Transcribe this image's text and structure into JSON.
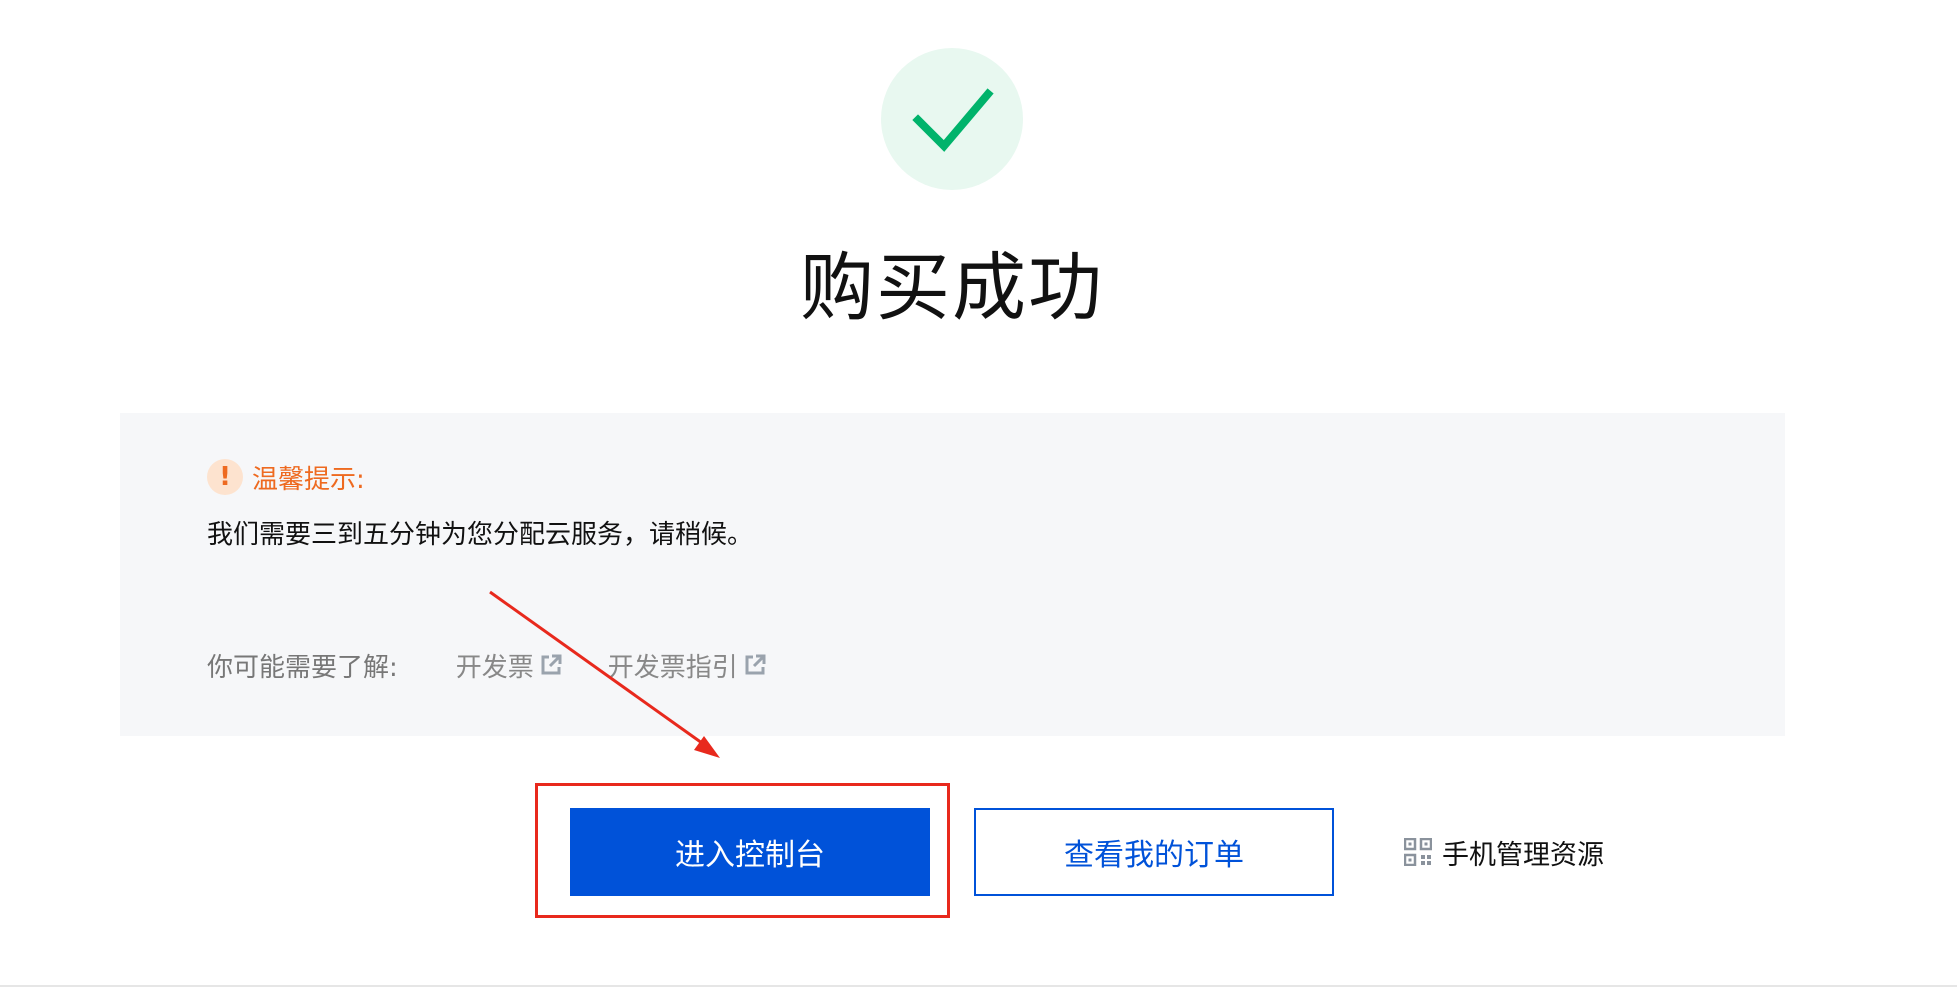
{
  "status": {
    "icon": "check-icon",
    "title": "购买成功",
    "accent_color": "#00b36b"
  },
  "notice": {
    "icon": "warning-icon",
    "title": "温馨提示:",
    "message": "我们需要三到五分钟为您分配云服务，请稍候。",
    "learn_more_label": "你可能需要了解:",
    "links": [
      {
        "label": "开发票",
        "icon": "external-link-icon"
      },
      {
        "label": "开发票指引",
        "icon": "external-link-icon"
      }
    ]
  },
  "actions": {
    "primary_label": "进入控制台",
    "secondary_label": "查看我的订单",
    "mobile_label": "手机管理资源",
    "mobile_icon": "qr-code-icon",
    "primary_color": "#0052d9",
    "highlight_color": "#e8291d"
  }
}
